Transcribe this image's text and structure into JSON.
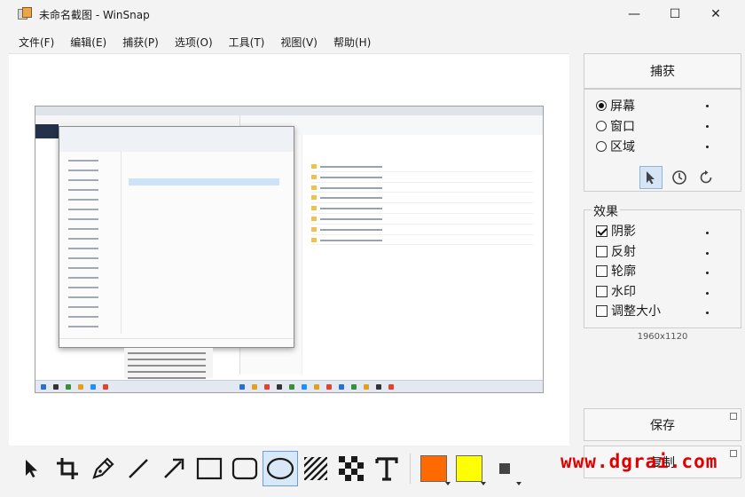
{
  "window": {
    "title": "未命名截图 - WinSnap",
    "minimize_glyph": "—",
    "maximize_glyph": "☐",
    "close_glyph": "✕"
  },
  "menu": [
    {
      "label": "文件(F)"
    },
    {
      "label": "编辑(E)"
    },
    {
      "label": "捕获(P)"
    },
    {
      "label": "选项(O)"
    },
    {
      "label": "工具(T)"
    },
    {
      "label": "视图(V)"
    },
    {
      "label": "帮助(H)"
    }
  ],
  "toolbar": {
    "tools": [
      "pointer-icon",
      "crop-icon",
      "pen-icon",
      "line-icon",
      "arrow-icon",
      "rectangle-icon",
      "rounded-rectangle-icon",
      "ellipse-icon",
      "hatch-icon",
      "checker-icon",
      "text-icon"
    ],
    "selected_tool": "ellipse-icon",
    "primary_color": "#ff6a00",
    "secondary_color": "#ffff00",
    "line_width_icon": "square-icon"
  },
  "panel": {
    "capture_label": "捕获",
    "modes": [
      {
        "label": "屏幕",
        "selected": true
      },
      {
        "label": "窗口",
        "selected": false
      },
      {
        "label": "区域",
        "selected": false
      }
    ],
    "effects_label": "效果",
    "effects": [
      {
        "label": "阴影",
        "checked": true
      },
      {
        "label": "反射",
        "checked": false
      },
      {
        "label": "轮廓",
        "checked": false
      },
      {
        "label": "水印",
        "checked": false
      },
      {
        "label": "调整大小",
        "checked": false
      }
    ],
    "image_size": "1960x1120",
    "save_label": "保存",
    "copy_label": "复制"
  },
  "watermark": "www.dgrai.com"
}
